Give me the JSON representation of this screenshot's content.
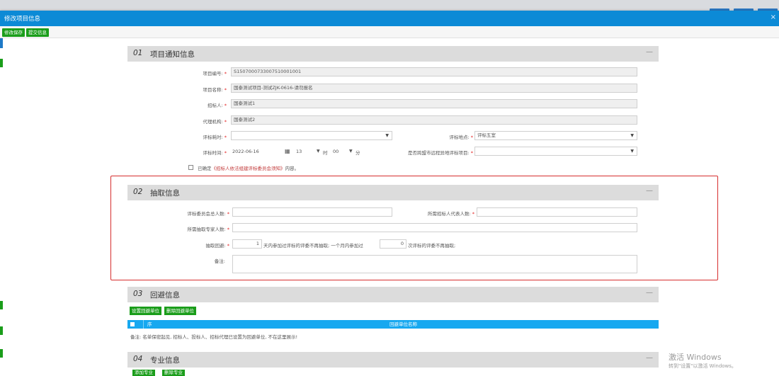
{
  "dialog": {
    "title": "修改项目信息",
    "close_icon": "×"
  },
  "toolbar": {
    "save": "修改保存",
    "submit": "提交信息"
  },
  "section1": {
    "num": "01",
    "title": "项目通知信息",
    "collapse": "—",
    "project_no_label": "项目编号:",
    "project_no": "S1507000733007510001001",
    "project_name_label": "项目名称:",
    "project_name": "国泰测试项目-测试ZJK-0616-请勿报名",
    "tenderer_label": "招标人:",
    "tenderer": "国泰测试1",
    "agency_label": "代理机构:",
    "agency": "国泰测试2",
    "duration_label": "评标耗时:",
    "duration": "",
    "location_label": "评标地点:",
    "location": "评标五室",
    "time_label": "评标时间:",
    "date": "2022-06-16",
    "hour": "13",
    "hour_unit": "时",
    "minute": "00",
    "minute_unit": "分",
    "cross_label": "是否跨盟市远程异地评标项目:",
    "cross": "",
    "confirm_prefix": "已确定",
    "confirm_link": "《招标人依法组建评标委员会须知》",
    "confirm_suffix": "内容。"
  },
  "section2": {
    "num": "02",
    "title": "抽取信息",
    "collapse": "—",
    "total_label": "评标委员会总人数:",
    "total": "",
    "rep_label": "所需招标人代表人数:",
    "rep": "",
    "expert_label": "所需抽取专家人数:",
    "expert": "",
    "avoid_label": "抽取回避:",
    "days": "1",
    "days_text": "天内参加过评标的评委不再抽取; 一个月内参加过",
    "times": "0",
    "times_text": "次评标的评委不再抽取;",
    "note_label": "备注:",
    "note": ""
  },
  "section3": {
    "num": "03",
    "title": "回避信息",
    "collapse": "—",
    "set_btn": "设置回避单位",
    "del_btn": "删除回避单位",
    "col_seq": "序",
    "col_name": "回避单位名称",
    "note": "备注: 名单保密起见, 招标人、投标人、招标代理已设置为回避单位, 不在这里展示!"
  },
  "section4": {
    "num": "04",
    "title": "专业信息",
    "collapse": "—",
    "add_btn": "添加专业",
    "del_btn": "删除专业"
  },
  "watermark": {
    "line1": "激活 Windows",
    "line2": "转到\"设置\"以激活 Windows。"
  },
  "colors": {
    "title_bar": "#0c8ad6",
    "green_btn": "#1a9d1a",
    "table_head": "#17a8f0",
    "highlight": "#d62e2e"
  }
}
